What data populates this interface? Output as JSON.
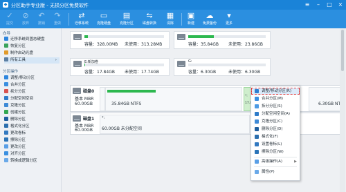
{
  "title_bar": {
    "title": "分区助手专业版 - 无损分区免费软件"
  },
  "toolbar": {
    "commit": "提交",
    "discard": "放弃",
    "undo": "撤销",
    "redo": "重做",
    "migrate": "迁移系统",
    "copy_disk": "克隆硬盘",
    "copy_partition": "克隆分区",
    "disk_convert": "磁盘转换",
    "wipe": "清除",
    "new": "新建",
    "free_backup": "免费备份",
    "more": "更多"
  },
  "sidebar": {
    "section1": "向导",
    "wizard": [
      {
        "label": "迁移系统到固态硬盘"
      },
      {
        "label": "恢复分区"
      },
      {
        "label": "制作启动光盘"
      },
      {
        "label": "所有工具"
      }
    ],
    "section2": "分区操作",
    "ops": [
      {
        "label": "调整/移动分区"
      },
      {
        "label": "合并分区"
      },
      {
        "label": "拆分分区"
      },
      {
        "label": "分配空闲空间"
      },
      {
        "label": "克隆分区"
      },
      {
        "label": "创建分区"
      },
      {
        "label": "删除分区"
      },
      {
        "label": "格式化分区"
      },
      {
        "label": "更改卷标"
      },
      {
        "label": "擦除分区"
      },
      {
        "label": "更改分区"
      },
      {
        "label": "对齐分区"
      },
      {
        "label": "转换成逻辑分区"
      }
    ]
  },
  "partition_cards": {
    "c1": {
      "cap": "容量：",
      "cap_val": "328.00MB",
      "free": "未使用：",
      "free_val": "313.28MB"
    },
    "c2": {
      "cap": "容量：",
      "cap_val": "35.84GB",
      "free": "未使用：",
      "free_val": "23.86GB"
    },
    "c3": {
      "name": "E:新加卷",
      "cap": "容量：",
      "cap_val": "17.84GB",
      "free": "未使用：",
      "free_val": "17.74GB"
    },
    "c4": {
      "name": "G:",
      "cap": "容量：",
      "cap_val": "6.30GB",
      "free": "未使用：",
      "free_val": "6.30GB"
    }
  },
  "disks": [
    {
      "name": "磁盘0",
      "type": "基本 MBR",
      "size": "60.00GB",
      "part_text": "35.84GB NTFS",
      "last_text": "6.30GB NTFS",
      "marker": "*:",
      "mid_text": "17.8"
    },
    {
      "name": "磁盘1",
      "type": "基本 MBR",
      "size": "60.00GB",
      "part_text": "60.00GB 未分配空间",
      "marker": "*:"
    }
  ],
  "context_menu": {
    "items": [
      {
        "label": "调整/移动分区(R)",
        "color": "#2e7fd1"
      },
      {
        "label": "合并分区(M)",
        "color": "#3a8fe0"
      },
      {
        "label": "拆分分区(S)",
        "color": "#4c9be4"
      },
      {
        "label": "分配空闲空间(A)",
        "color": "#2f7cc9"
      },
      {
        "label": "克隆分区(C)",
        "color": "#3e8ad6"
      },
      {
        "label": "删除分区(D)",
        "color": "#1f5f9f"
      },
      {
        "label": "格式化(F)",
        "color": "#2b6fae"
      },
      {
        "label": "设置卷标(L)",
        "color": "#3279c0"
      },
      {
        "label": "擦除分区(W)",
        "color": "#2a74b8"
      },
      {
        "label": "高级操作(A)",
        "color": "#5a9fe6"
      },
      {
        "label": "属性(P)",
        "color": "#6aa9e8"
      }
    ]
  },
  "colors": {
    "title": "#1a83d8",
    "toolbar": "#2b8fe0",
    "used": "#2db84f",
    "highlight": "#e03a3a"
  }
}
